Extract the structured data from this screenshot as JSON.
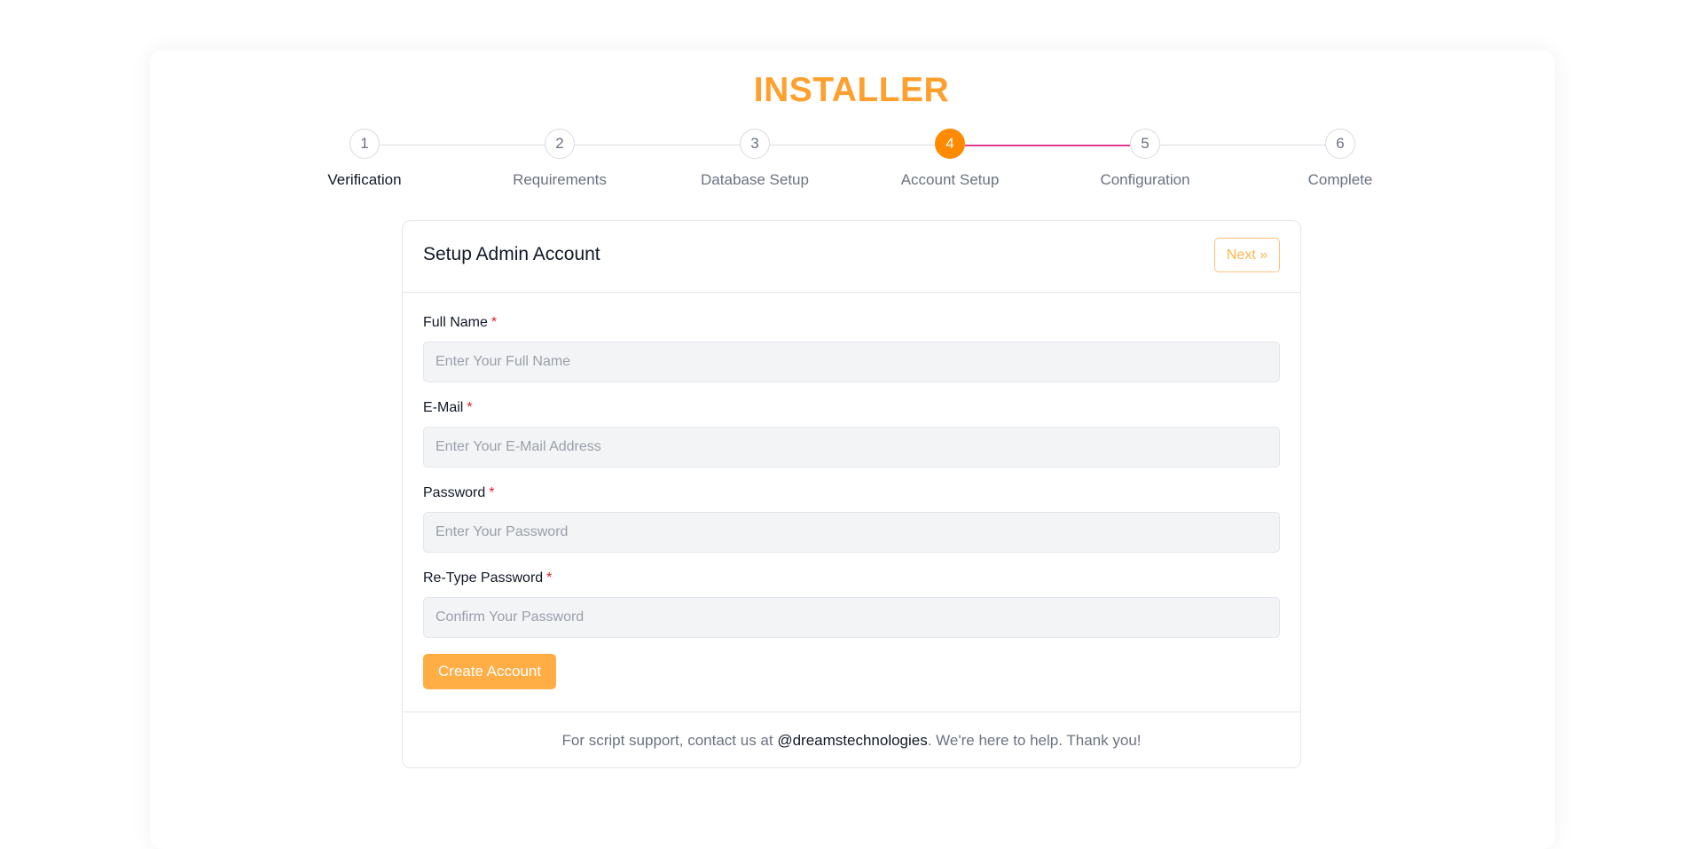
{
  "header": {
    "title": "INSTALLER"
  },
  "stepper": {
    "current_step": 4,
    "steps": [
      {
        "number": "1",
        "label": "Verification"
      },
      {
        "number": "2",
        "label": "Requirements"
      },
      {
        "number": "3",
        "label": "Database Setup"
      },
      {
        "number": "4",
        "label": "Account Setup"
      },
      {
        "number": "5",
        "label": "Configuration"
      },
      {
        "number": "6",
        "label": "Complete"
      }
    ]
  },
  "form": {
    "title": "Setup Admin Account",
    "next_label": "Next »",
    "required_marker": "*",
    "fields": [
      {
        "label": "Full Name",
        "placeholder": "Enter Your Full Name",
        "value": ""
      },
      {
        "label": "E-Mail",
        "placeholder": "Enter Your E-Mail Address",
        "value": ""
      },
      {
        "label": "Password",
        "placeholder": "Enter Your Password",
        "value": ""
      },
      {
        "label": "Re-Type Password",
        "placeholder": "Confirm Your Password",
        "value": ""
      }
    ],
    "submit_label": "Create Account"
  },
  "footer": {
    "text_before": "For script support, contact us at ",
    "link_text": "@dreamstechnologies",
    "text_after": ". We're here to help. Thank you!"
  },
  "colors": {
    "accent": "#ff9f2d",
    "current_step": "#ff8a00",
    "active_line": "#e33b8e",
    "required": "#e11d2a"
  }
}
